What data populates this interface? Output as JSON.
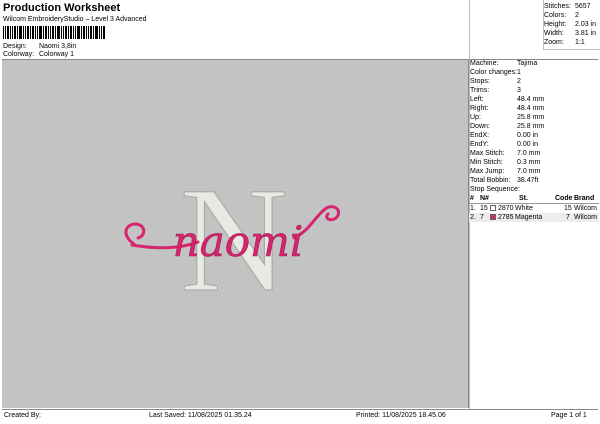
{
  "header": {
    "title": "Production Worksheet",
    "subtitle": "Wilcom EmbroideryStudio – Level 3 Advanced",
    "design_label": "Design:",
    "design_value": "Naomi 3,8in",
    "colorway_label": "Colorway:",
    "colorway_value": "Colorway 1"
  },
  "stats": {
    "stitches_label": "Stitches:",
    "stitches_value": "5657",
    "colors_label": "Colors:",
    "colors_value": "2",
    "height_label": "Height:",
    "height_value": "2.03 in",
    "width_label": "Width:",
    "width_value": "3.81 in",
    "zoom_label": "Zoom:",
    "zoom_value": "1:1"
  },
  "info": [
    {
      "label": "Machine:",
      "value": "Tajima"
    },
    {
      "label": "Color changes:",
      "value": "1"
    },
    {
      "label": "Stops:",
      "value": "2"
    },
    {
      "label": "Trims:",
      "value": "3"
    },
    {
      "label": "Left:",
      "value": "48.4 mm"
    },
    {
      "label": "Right:",
      "value": "48.4 mm"
    },
    {
      "label": "Up:",
      "value": "25.8 mm"
    },
    {
      "label": "Down:",
      "value": "25.8 mm"
    },
    {
      "label": "EndX:",
      "value": "0.00 in"
    },
    {
      "label": "EndY:",
      "value": "0.00 in"
    },
    {
      "label": "Max Stitch:",
      "value": "7.0 mm"
    },
    {
      "label": "Min Stitch:",
      "value": "0.3 mm"
    },
    {
      "label": "Max Jump:",
      "value": "7.0 mm"
    },
    {
      "label": "Total Bobbin:",
      "value": "38.47ft"
    }
  ],
  "stop_sequence": {
    "title": "Stop Sequence:",
    "headers": {
      "num": "#",
      "n": "N#",
      "st": "St.",
      "code": "Code",
      "brand": "Brand"
    },
    "rows": [
      {
        "num": "1.",
        "n": "15",
        "code_name": "2870",
        "name": "White",
        "code": "15",
        "brand": "Wilcom",
        "color": "#ffffff"
      },
      {
        "num": "2.",
        "n": "7",
        "code_name": "2785",
        "name": "Magenta",
        "code": "7",
        "brand": "Wilcom",
        "color": "#d6246e"
      }
    ]
  },
  "design": {
    "monogram": "N",
    "script": "naomi",
    "thread_white": "#e8ece4",
    "thread_magenta": "#d6246e"
  },
  "footer": {
    "created_by": "Created By:",
    "last_saved": "Last Saved: 11/08/2025 01.35.24",
    "printed": "Printed: 11/08/2025 18.45.06",
    "page": "Page 1 of 1"
  }
}
